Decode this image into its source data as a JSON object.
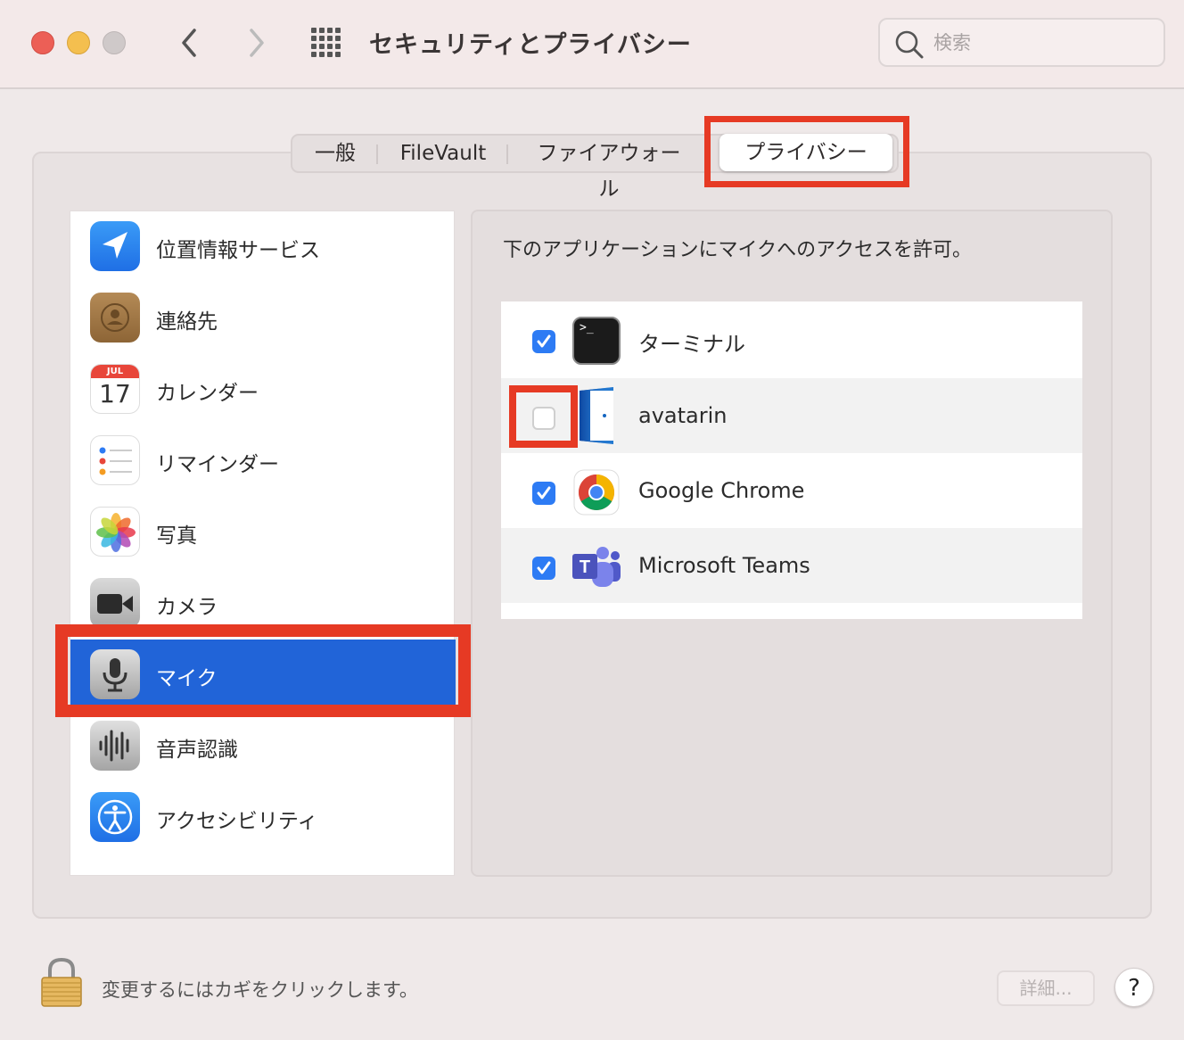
{
  "window": {
    "title": "セキュリティとプライバシー",
    "search_placeholder": "検索"
  },
  "tabs": [
    {
      "label": "一般"
    },
    {
      "label": "FileVault"
    },
    {
      "label": "ファイアウォール"
    },
    {
      "label": "プライバシー",
      "selected": true
    }
  ],
  "sidebar": {
    "items": [
      {
        "label": "位置情報サービス",
        "icon": "location-arrow-icon"
      },
      {
        "label": "連絡先",
        "icon": "contacts-icon"
      },
      {
        "label": "カレンダー",
        "icon": "calendar-icon",
        "calendar_month": "JUL",
        "calendar_day": "17"
      },
      {
        "label": "リマインダー",
        "icon": "reminders-icon"
      },
      {
        "label": "写真",
        "icon": "photos-icon"
      },
      {
        "label": "カメラ",
        "icon": "camera-icon"
      },
      {
        "label": "マイク",
        "icon": "microphone-icon",
        "selected": true
      },
      {
        "label": "音声認識",
        "icon": "speech-recognition-icon"
      },
      {
        "label": "アクセシビリティ",
        "icon": "accessibility-icon"
      }
    ]
  },
  "main": {
    "description": "下のアプリケーションにマイクへのアクセスを許可。",
    "apps": [
      {
        "name": "ターミナル",
        "checked": true,
        "icon": "terminal-icon",
        "terminal_prompt": ">_"
      },
      {
        "name": "avatarin",
        "checked": false,
        "icon": "avatarin-icon"
      },
      {
        "name": "Google Chrome",
        "checked": true,
        "icon": "chrome-icon"
      },
      {
        "name": "Microsoft Teams",
        "checked": true,
        "icon": "teams-icon",
        "teams_letter": "T"
      }
    ]
  },
  "footer": {
    "lock_text": "変更するにはカギをクリックします。",
    "detail_button": "詳細...",
    "help_button": "?"
  },
  "colors": {
    "highlight": "#e63a24",
    "selection": "#2164d8",
    "checkbox": "#2d7bf4"
  }
}
